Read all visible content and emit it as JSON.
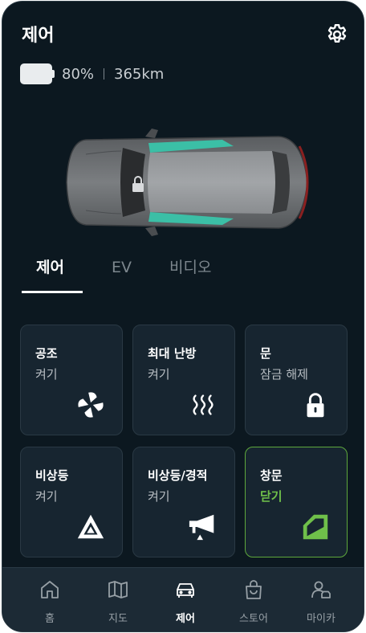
{
  "header": {
    "title": "제어",
    "settings_icon": "gear-icon"
  },
  "status": {
    "battery_level": 0.8,
    "battery_text": "80%",
    "range_text": "365km"
  },
  "tabs": [
    {
      "label": "제어",
      "active": true
    },
    {
      "label": "EV",
      "active": false
    },
    {
      "label": "비디오",
      "active": false
    }
  ],
  "controls": [
    {
      "title": "공조",
      "state": "켜기",
      "icon": "fan-icon",
      "active": false
    },
    {
      "title": "최대 난방",
      "state": "켜기",
      "icon": "heat-icon",
      "active": false
    },
    {
      "title": "문",
      "state": "잠금 해제",
      "icon": "lock-icon",
      "active": false
    },
    {
      "title": "비상등",
      "state": "켜기",
      "icon": "hazard-icon",
      "active": false
    },
    {
      "title": "비상등/경적",
      "state": "켜기",
      "icon": "horn-icon",
      "active": false
    },
    {
      "title": "창문",
      "state": "닫기",
      "icon": "window-icon",
      "active": true
    }
  ],
  "nav": [
    {
      "label": "홈",
      "icon": "home-icon",
      "active": false
    },
    {
      "label": "지도",
      "icon": "map-icon",
      "active": false
    },
    {
      "label": "제어",
      "icon": "car-icon",
      "active": true
    },
    {
      "label": "스토어",
      "icon": "store-bag-icon",
      "active": false
    },
    {
      "label": "마이카",
      "icon": "mycar-person-icon",
      "active": false
    }
  ],
  "colors": {
    "background": "#0c1820",
    "card": "#172530",
    "accent_green": "#6fc04a",
    "window_tint": "#3bbfa6"
  }
}
